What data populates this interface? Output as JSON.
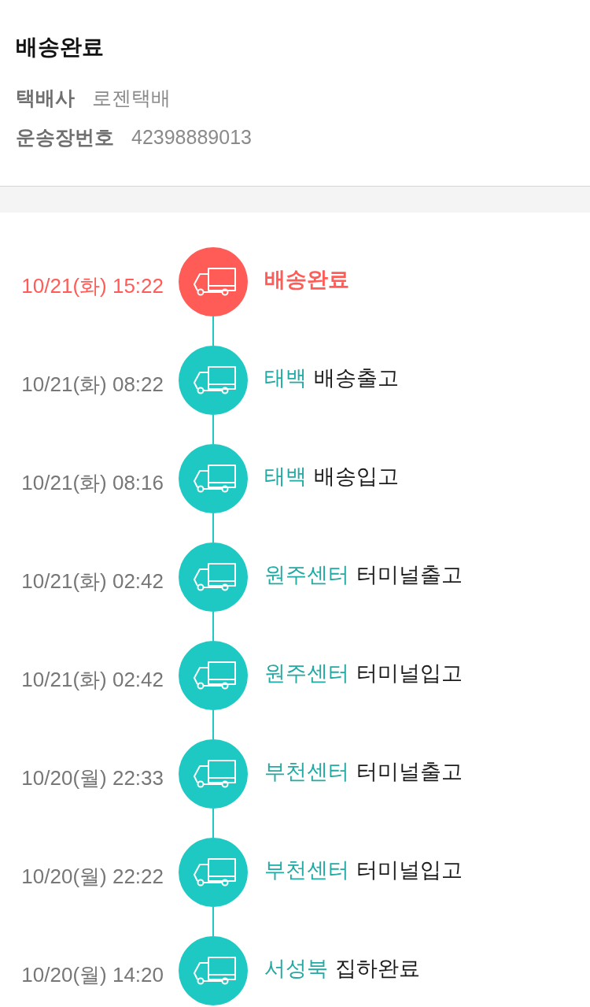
{
  "header": {
    "title": "배송완료",
    "fields": [
      {
        "label": "택배사",
        "value": "로젠택배"
      },
      {
        "label": "운송장번호",
        "value": "42398889013"
      }
    ]
  },
  "events": [
    {
      "time": "10/21(화) 15:22",
      "status": "배송완료",
      "current": true
    },
    {
      "time": "10/21(화) 08:22",
      "place": "태백",
      "status": "배송출고",
      "current": false
    },
    {
      "time": "10/21(화) 08:16",
      "place": "태백",
      "status": "배송입고",
      "current": false
    },
    {
      "time": "10/21(화) 02:42",
      "place": "원주센터",
      "status": "터미널출고",
      "current": false
    },
    {
      "time": "10/21(화) 02:42",
      "place": "원주센터",
      "status": "터미널입고",
      "current": false
    },
    {
      "time": "10/20(월) 22:33",
      "place": "부천센터",
      "status": "터미널출고",
      "current": false
    },
    {
      "time": "10/20(월) 22:22",
      "place": "부천센터",
      "status": "터미널입고",
      "current": false
    },
    {
      "time": "10/20(월) 14:20",
      "place": "서성북",
      "status": "집하완료",
      "current": false
    }
  ]
}
